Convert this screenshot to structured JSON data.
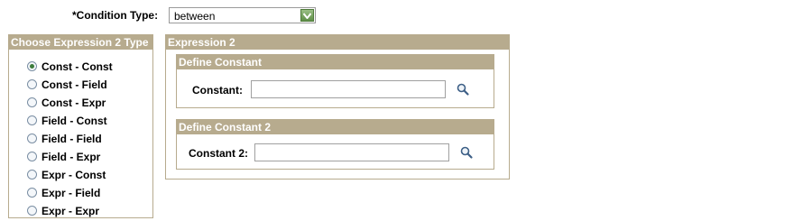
{
  "condition": {
    "label": "*Condition Type:",
    "selected": "between"
  },
  "left_panel": {
    "title": "Choose Expression 2 Type",
    "options": [
      {
        "label": "Const - Const",
        "checked": true
      },
      {
        "label": "Const - Field",
        "checked": false
      },
      {
        "label": "Const - Expr",
        "checked": false
      },
      {
        "label": "Field - Const",
        "checked": false
      },
      {
        "label": "Field - Field",
        "checked": false
      },
      {
        "label": "Field - Expr",
        "checked": false
      },
      {
        "label": "Expr - Const",
        "checked": false
      },
      {
        "label": "Expr - Field",
        "checked": false
      },
      {
        "label": "Expr - Expr",
        "checked": false
      }
    ]
  },
  "right_panel": {
    "title": "Expression 2",
    "constant_box": {
      "title": "Define Constant",
      "field_label": "Constant:",
      "value": ""
    },
    "constant2_box": {
      "title": "Define Constant 2",
      "field_label": "Constant 2:",
      "value": ""
    }
  },
  "colors": {
    "header_bg": "#b7ab8e",
    "header_text": "#ffffff",
    "dropdown_button": "#6f9a58"
  },
  "icons": {
    "dropdown": "chevron-down-icon",
    "lookup": "magnifier-icon"
  }
}
